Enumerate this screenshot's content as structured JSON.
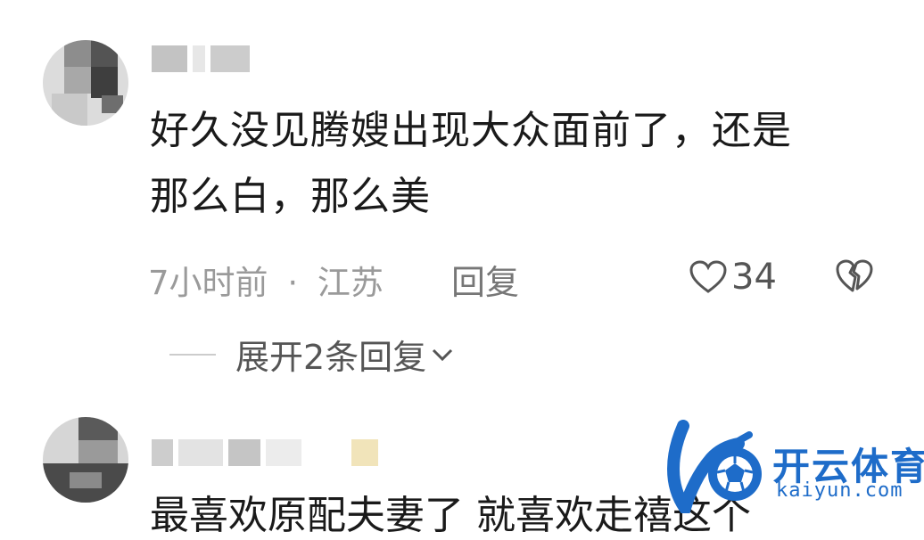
{
  "comments": [
    {
      "content": "好久没见腾嫂出现大众面前了，还是\n那么白，那么美",
      "time": "7小时前",
      "separator": "·",
      "location": "江苏",
      "reply_label": "回复",
      "like_count": "34",
      "expand_label": "展开2条回复"
    },
    {
      "content": "最喜欢原配夫妻了 就喜欢走禧这个"
    }
  ],
  "watermark": {
    "brand_cn": "开云体育",
    "brand_en": "kaiyun.com",
    "color": "#1e6cc9"
  },
  "icons": {
    "like": "heart-outline-icon",
    "dislike": "broken-heart-icon",
    "expand": "chevron-down-icon"
  }
}
